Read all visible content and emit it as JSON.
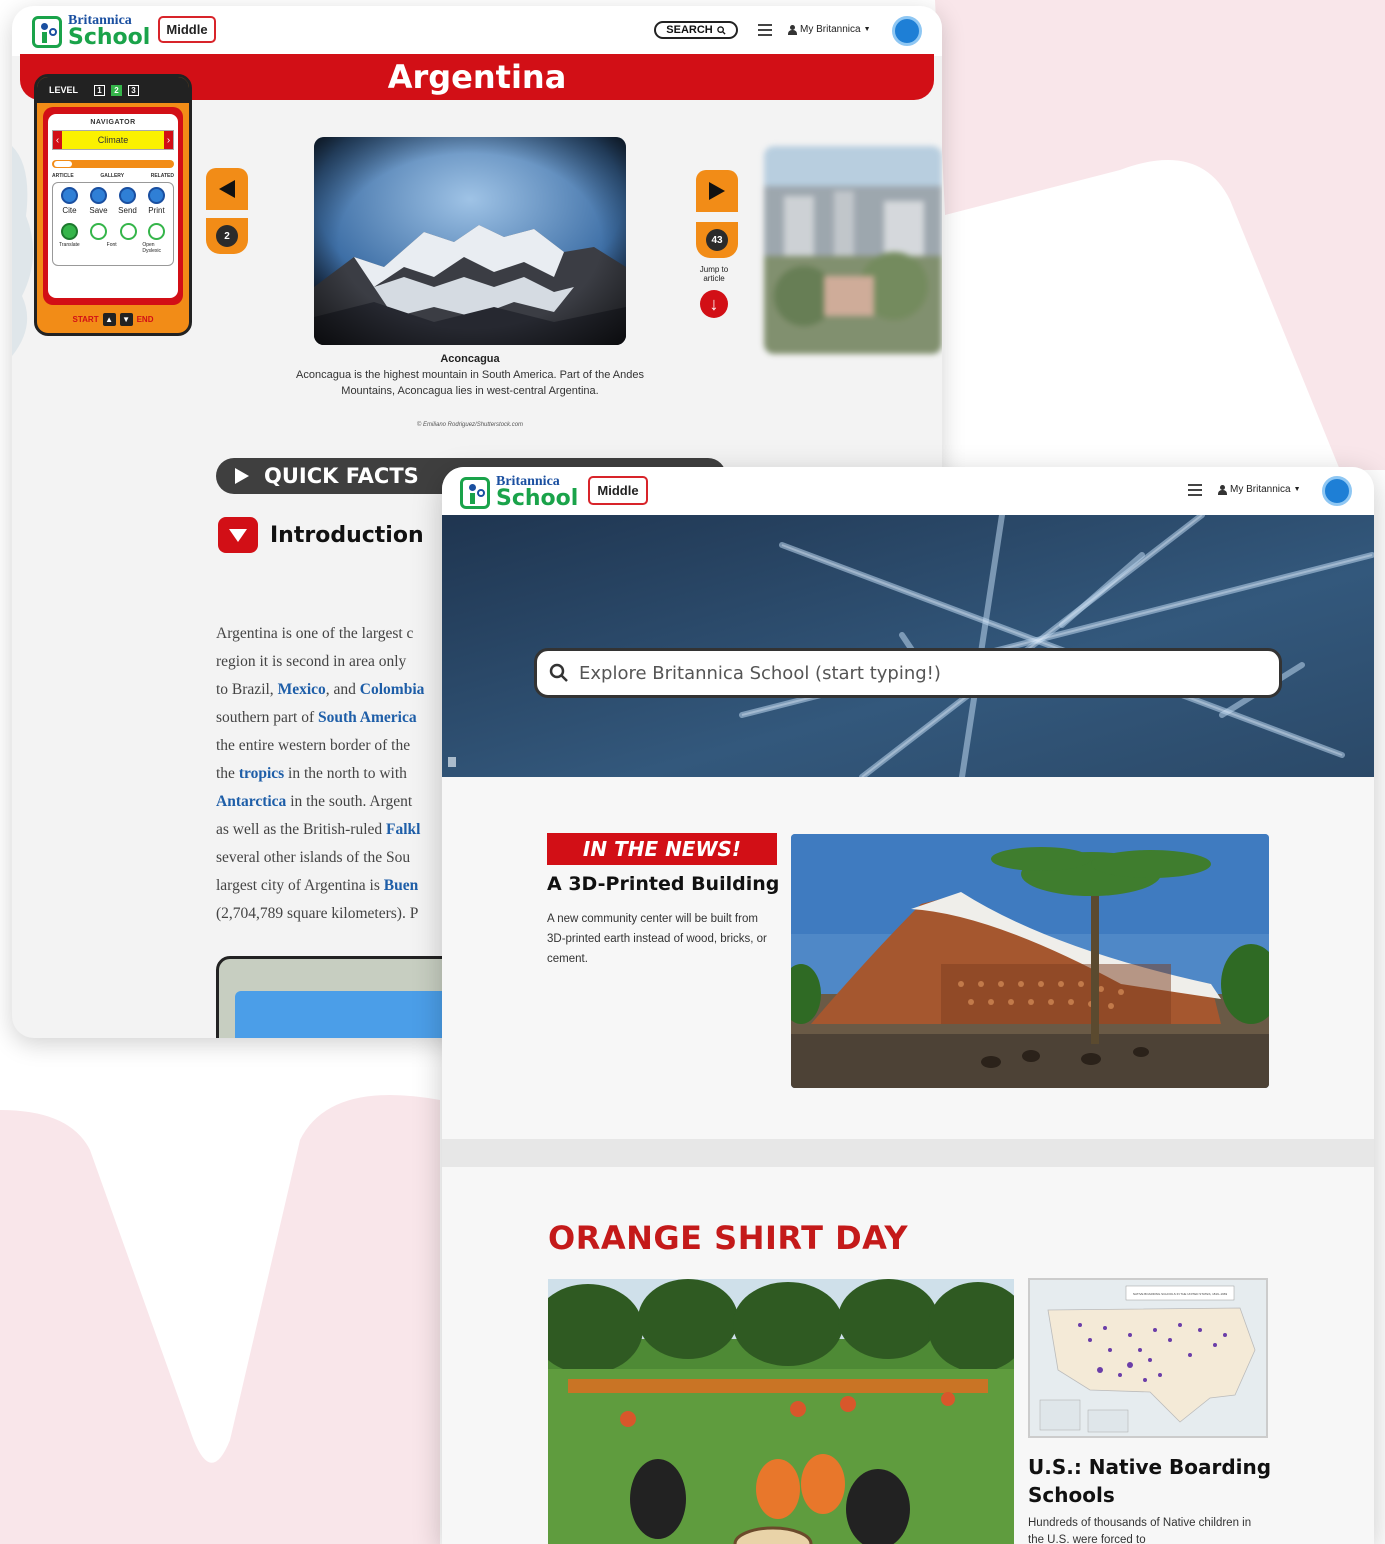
{
  "colors": {
    "brand_red": "#d20f16",
    "brand_green": "#1aa34a",
    "brand_blue": "#1a4fa0",
    "accent_orange": "#f28c17",
    "background_pink": "#f9e6ea"
  },
  "back_window": {
    "logo": {
      "top": "Britannica",
      "bottom": "School"
    },
    "level_badge": "Middle",
    "search_label": "SEARCH",
    "my_britannica": "My Britannica",
    "page_title": "Argentina",
    "navigator": {
      "level_label": "LEVEL",
      "levels": [
        "1",
        "2",
        "3"
      ],
      "header": "NAVIGATOR",
      "selected": "Climate",
      "progress_fraction": 0.15,
      "tabs": [
        "ARTICLE",
        "GALLERY",
        "RELATED"
      ],
      "tools_row1": [
        "Cite",
        "Save",
        "Send",
        "Print"
      ],
      "tools_row2": [
        "Translate",
        "",
        "",
        "Open Dyslexic"
      ],
      "font_label": "Font",
      "start_label": "START",
      "end_label": "END"
    },
    "prev_count": "2",
    "next_count": "43",
    "jump_label": "Jump to article",
    "image_caption": {
      "title": "Aconcagua",
      "text": "Aconcagua is the highest mountain in South America. Part of the Andes Mountains, Aconcagua lies in west-central Argentina.",
      "credit": "© Emiliano Rodriguez/Shutterstock.com"
    },
    "quick_facts": "QUICK FACTS",
    "introduction": "Introduction",
    "article_lines": [
      {
        "pre": "Argentina is one of the largest c",
        "link": "",
        "post": ""
      },
      {
        "pre": "region it is second in area only",
        "link": "",
        "post": ""
      },
      {
        "pre": "to Brazil, ",
        "link": "Mexico",
        "post": ", and ",
        "link2": "Colombia"
      },
      {
        "pre": "southern part of ",
        "link": "South America",
        "post": ""
      },
      {
        "pre": "the entire western border of the",
        "link": "",
        "post": ""
      },
      {
        "pre": "the ",
        "link": "tropics",
        "post": " in the north to with"
      },
      {
        "pre": "",
        "link": "Antarctica",
        "post": " in the south. Argent"
      },
      {
        "pre": "as well as the British-ruled ",
        "link": "Falkl",
        "post": ""
      },
      {
        "pre": "several other islands of the Sou",
        "link": "",
        "post": ""
      },
      {
        "pre": "largest city of Argentina is ",
        "link": "Buen",
        "post": ""
      },
      {
        "pre": "(2,704,789 square kilometers). P",
        "link": "",
        "post": ""
      }
    ]
  },
  "front_window": {
    "logo": {
      "top": "Britannica",
      "bottom": "School"
    },
    "level_badge": "Middle",
    "my_britannica": "My Britannica",
    "search_placeholder": "Explore Britannica School (start typing!)",
    "news": {
      "tag": "IN THE NEWS!",
      "title": "A 3D-Printed Building",
      "description": "A new community center will be built from 3D-printed earth instead of wood, bricks, or cement."
    },
    "feature": {
      "section_title": "ORANGE SHIRT DAY",
      "map_title": "NATIVE BOARDING SCHOOLS IN THE UNITED STATES, 1819–1969",
      "card_title": "U.S.: Native Boarding Schools",
      "card_desc": "Hundreds of thousands of Native children in the U.S. were forced to"
    }
  }
}
